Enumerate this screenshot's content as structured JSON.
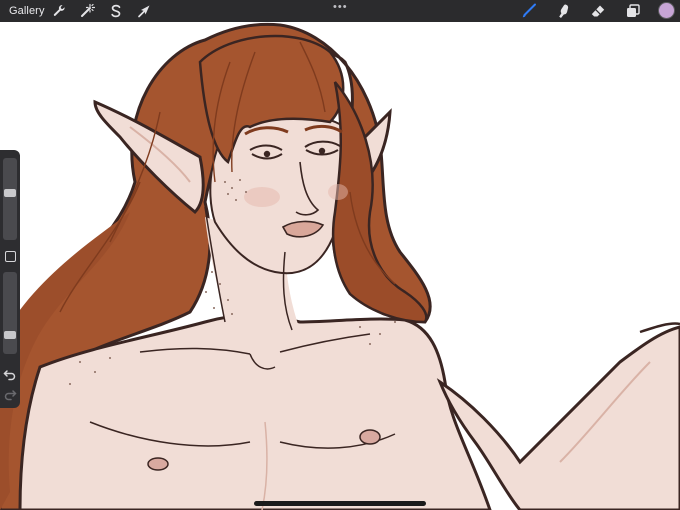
{
  "toolbar": {
    "gallery_label": "Gallery",
    "left_tools": [
      {
        "icon": "wrench-icon",
        "name": "actions"
      },
      {
        "icon": "magic-wand-icon",
        "name": "adjustments"
      },
      {
        "icon": "selection-s-icon",
        "name": "selection"
      },
      {
        "icon": "transform-arrow-icon",
        "name": "transform"
      }
    ],
    "more_label": "•••",
    "right_tools": [
      {
        "icon": "brush-icon",
        "name": "paint",
        "active": true
      },
      {
        "icon": "smudge-icon",
        "name": "smudge"
      },
      {
        "icon": "eraser-icon",
        "name": "erase"
      },
      {
        "icon": "layers-icon",
        "name": "layers"
      }
    ],
    "current_color": "#c7a5d6",
    "active_tool_color": "#2f7bf6"
  },
  "sidebar": {
    "brush_size_level": 0.58,
    "opacity_level": 0.2,
    "modifier_icon": "square-modifier-icon",
    "undo_icon": "undo-arrow-icon",
    "redo_icon": "redo-arrow-icon"
  },
  "canvas": {
    "subject": "elf-portrait-illustration",
    "colors": {
      "hair": "#a5552f",
      "hair_dark": "#7f3b1e",
      "skin": "#f1ddd6",
      "skin_shadow": "#e6cbc2",
      "outline": "#3a2522",
      "lips": "#d9a79a",
      "freckles": "#8a6a60"
    }
  }
}
